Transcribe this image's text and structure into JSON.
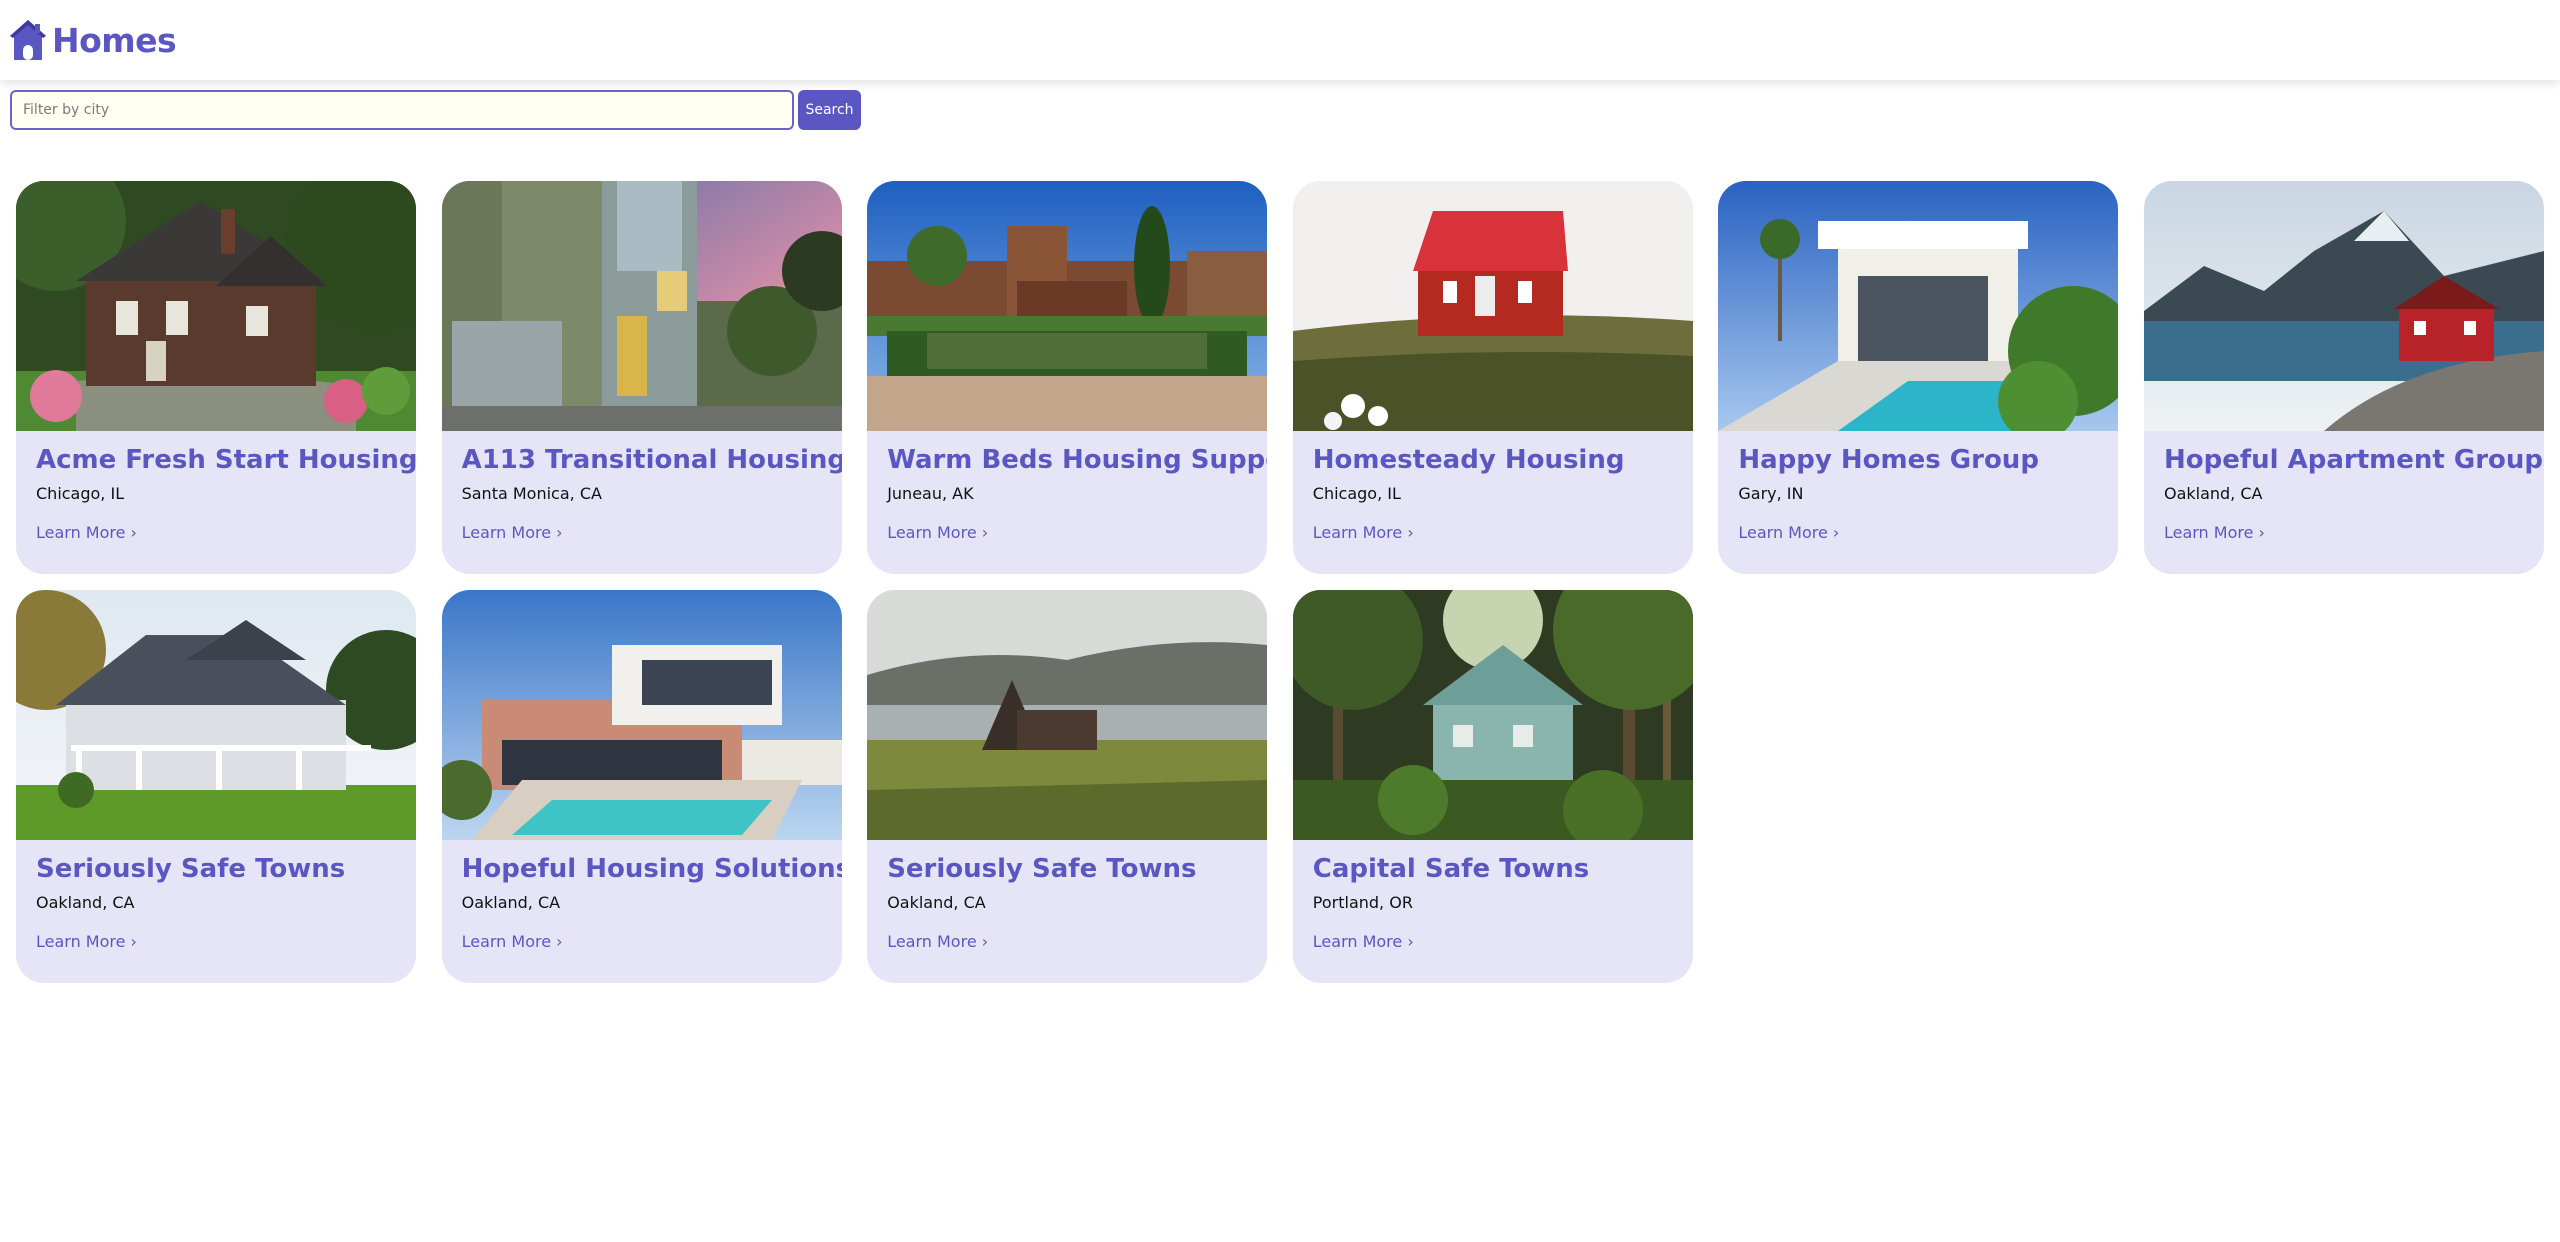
{
  "header": {
    "title": "Homes",
    "logo_icon": "house-icon",
    "accent_color": "#5b57c2"
  },
  "search": {
    "placeholder": "Filter by city",
    "value": "",
    "button_label": "Search"
  },
  "listings": [
    {
      "name": "Acme Fresh Start Housing",
      "city": "Chicago, IL",
      "link": "Learn More ›",
      "photo": "brick-cottage-garden"
    },
    {
      "name": "A113 Transitional Housing",
      "city": "Santa Monica, CA",
      "link": "Learn More ›",
      "photo": "modern-house-sunset"
    },
    {
      "name": "Warm Beds Housing Support",
      "city": "Juneau, AK",
      "link": "Learn More ›",
      "photo": "palace-reflecting-pool"
    },
    {
      "name": "Homesteady Housing",
      "city": "Chicago, IL",
      "link": "Learn More ›",
      "photo": "red-roof-cabin-field"
    },
    {
      "name": "Happy Homes Group",
      "city": "Gary, IN",
      "link": "Learn More ›",
      "photo": "white-villa-pool"
    },
    {
      "name": "Hopeful Apartment Group",
      "city": "Oakland, CA",
      "link": "Learn More ›",
      "photo": "red-house-fjord"
    },
    {
      "name": "Seriously Safe Towns",
      "city": "Oakland, CA",
      "link": "Learn More ›",
      "photo": "grey-house-porch"
    },
    {
      "name": "Hopeful Housing Solutions",
      "city": "Oakland, CA",
      "link": "Learn More ›",
      "photo": "modern-villa-pool"
    },
    {
      "name": "Seriously Safe Towns",
      "city": "Oakland, CA",
      "link": "Learn More ›",
      "photo": "a-frame-cabin-lake"
    },
    {
      "name": "Capital Safe Towns",
      "city": "Portland, OR",
      "link": "Learn More ›",
      "photo": "forest-house"
    }
  ]
}
